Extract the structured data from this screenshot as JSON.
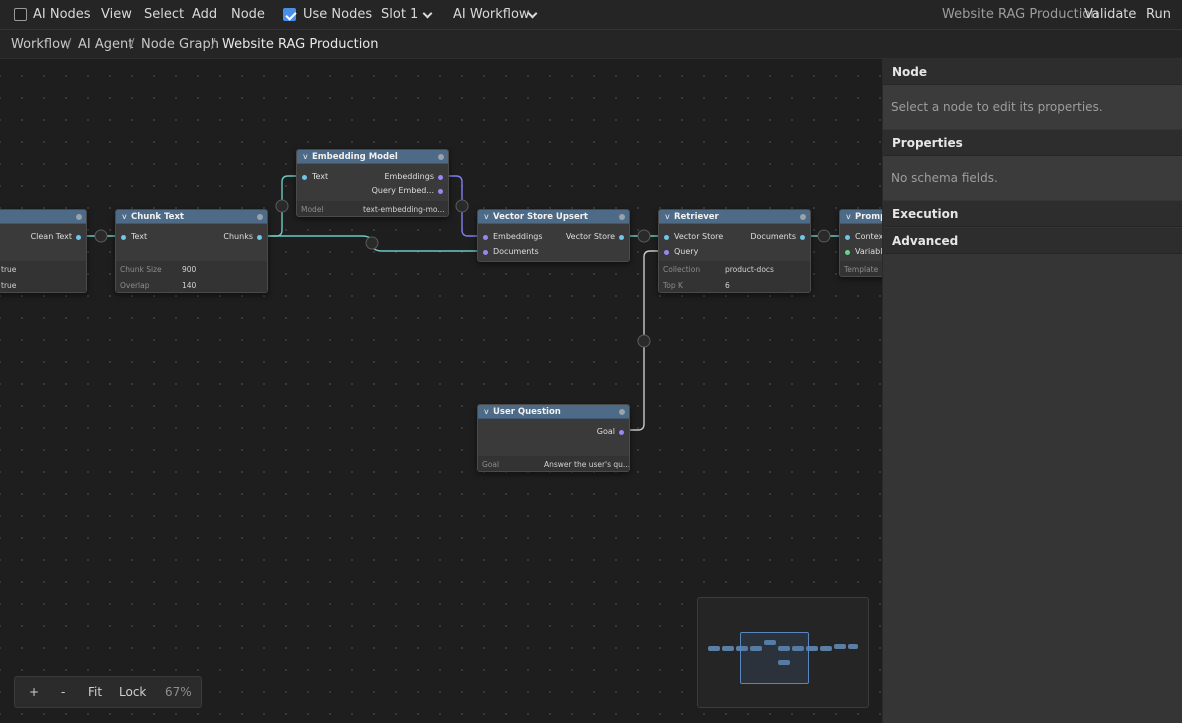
{
  "topbar": {
    "ai_nodes_label": "AI Nodes",
    "ai_nodes_checked": false,
    "menu": [
      "View",
      "Select",
      "Add",
      "Node"
    ],
    "use_nodes_label": "Use Nodes",
    "use_nodes_checked": true,
    "slot_value": "Slot 1",
    "workflow_value": "AI Workflow",
    "document_title": "Website RAG Production",
    "validate_label": "Validate",
    "run_label": "Run"
  },
  "breadcrumb": {
    "items": [
      "Workflow",
      "AI Agent",
      "Node Graph",
      "Website RAG Production"
    ],
    "separator": "/"
  },
  "nodes": {
    "clean": {
      "out_clean_text": "Clean Text",
      "prop1_value": "true",
      "prop2_value": "true"
    },
    "chunk": {
      "title": "Chunk Text",
      "in_text": "Text",
      "out_chunks": "Chunks",
      "props": [
        {
          "key": "Chunk Size",
          "value": "900"
        },
        {
          "key": "Overlap",
          "value": "140"
        }
      ]
    },
    "embed": {
      "title": "Embedding Model",
      "in_text": "Text",
      "out_embeddings": "Embeddings",
      "out_query": "Query Embed...",
      "props": [
        {
          "key": "Model",
          "value": "text-embedding-mo..."
        }
      ]
    },
    "upsert": {
      "title": "Vector Store Upsert",
      "in_embeddings": "Embeddings",
      "in_documents": "Documents",
      "out_store": "Vector Store"
    },
    "retriever": {
      "title": "Retriever",
      "in_store": "Vector Store",
      "in_query": "Query",
      "out_documents": "Documents",
      "props": [
        {
          "key": "Collection",
          "value": "product-docs"
        },
        {
          "key": "Top K",
          "value": "6"
        }
      ]
    },
    "prompt": {
      "title": "Prompt",
      "in_context": "Context",
      "in_variables": "Variables",
      "prop_key": "Template"
    },
    "question": {
      "title": "User Question",
      "out_goal": "Goal",
      "props": [
        {
          "key": "Goal",
          "value": "Answer the user's qu..."
        }
      ]
    }
  },
  "zoom": {
    "plus": "+",
    "minus": "-",
    "fit": "Fit",
    "lock": "Lock",
    "level": "67%"
  },
  "panel": {
    "node_title": "Node",
    "node_hint": "Select a node to edit its properties.",
    "properties_title": "Properties",
    "properties_hint": "No schema fields.",
    "execution_title": "Execution",
    "advanced_title": "Advanced"
  },
  "colors": {
    "accent": "#4a8fe6",
    "node_header": "#4d6a86",
    "wire_text": "#6fc7c0",
    "wire_embed": "#7f7ff0",
    "wire_query": "#c8c8c8",
    "port_text": "#6ec6e8",
    "port_purple": "#9a86f0",
    "port_green": "#64d68a"
  },
  "icons": [
    "checkbox-icon",
    "chevron-down-icon",
    "collapse-triangle-icon",
    "node-status-dot-icon",
    "reroute-icon"
  ]
}
